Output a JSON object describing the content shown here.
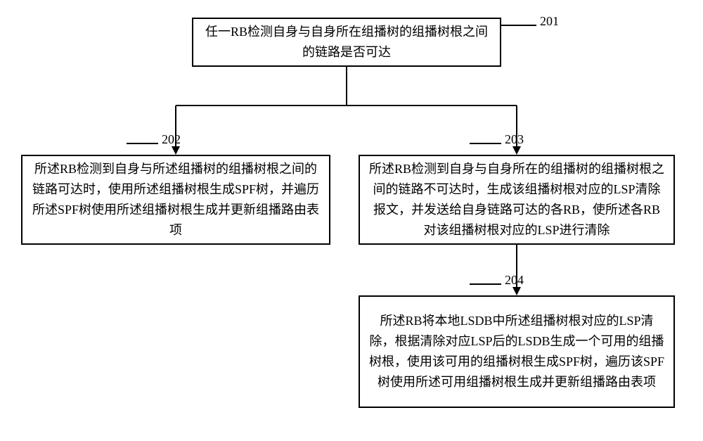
{
  "diagram": {
    "box201": {
      "label": "201",
      "text": "任一RB检测自身与自身所在组播树的组播树根之间的链路是否可达"
    },
    "box202": {
      "label": "202",
      "text": "所述RB检测到自身与所述组播树的组播树根之间的链路可达时，使用所述组播树根生成SPF树，并遍历所述SPF树使用所述组播树根生成并更新组播路由表项"
    },
    "box203": {
      "label": "203",
      "text": "所述RB检测到自身与自身所在的组播树的组播树根之间的链路不可达时，生成该组播树根对应的LSP清除报文，并发送给自身链路可达的各RB，使所述各RB对该组播树根对应的LSP进行清除"
    },
    "box204": {
      "label": "204",
      "text": "所述RB将本地LSDB中所述组播树根对应的LSP清除，根据清除对应LSP后的LSDB生成一个可用的组播树根，使用该可用的组播树根生成SPF树，遍历该SPF树使用所述可用组播树根生成并更新组播路由表项"
    }
  }
}
